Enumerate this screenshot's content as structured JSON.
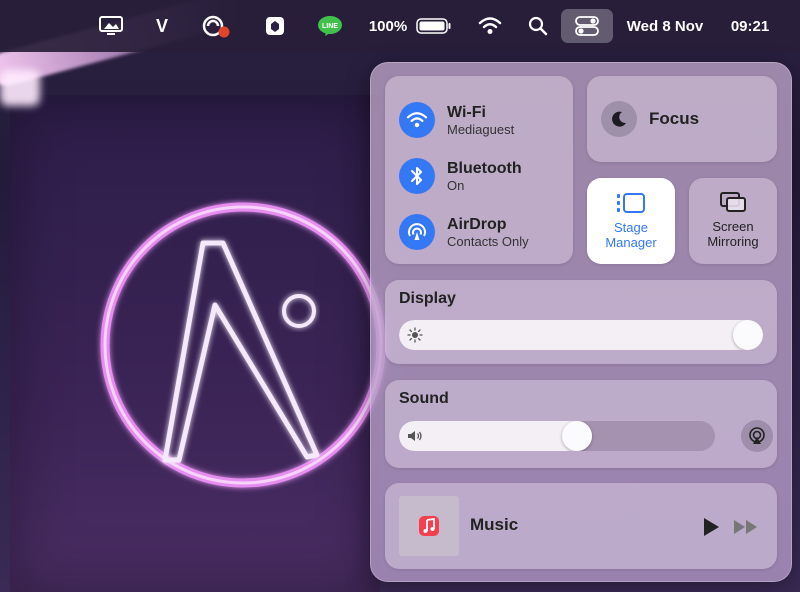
{
  "menubar": {
    "v_label": "V",
    "battery_percent": "100%",
    "battery_level": 1.0,
    "date": "Wed 8 Nov",
    "time": "09:21",
    "icons": [
      "screen-share-icon",
      "v-app-icon",
      "cloud-sync-icon",
      "vpn-app-icon",
      "line-app-icon",
      "battery-icon",
      "wifi-icon",
      "search-icon",
      "control-center-icon"
    ],
    "line_badge": "LINE"
  },
  "control_center": {
    "network": {
      "wifi": {
        "title": "Wi-Fi",
        "subtitle": "Mediaguest",
        "icon": "wifi-icon"
      },
      "bluetooth": {
        "title": "Bluetooth",
        "subtitle": "On",
        "icon": "bluetooth-icon"
      },
      "airdrop": {
        "title": "AirDrop",
        "subtitle": "Contacts Only",
        "icon": "airdrop-icon"
      }
    },
    "focus": {
      "label": "Focus",
      "icon": "moon-icon"
    },
    "stage_manager": {
      "line1": "Stage",
      "line2": "Manager",
      "active": true
    },
    "screen_mirroring": {
      "line1": "Screen",
      "line2": "Mirroring"
    },
    "display": {
      "title": "Display",
      "brightness": 1.0
    },
    "sound": {
      "title": "Sound",
      "volume": 0.57
    },
    "now_playing": {
      "label": "Music",
      "icon": "music-note-icon"
    },
    "accent_color": "#3478f6"
  }
}
